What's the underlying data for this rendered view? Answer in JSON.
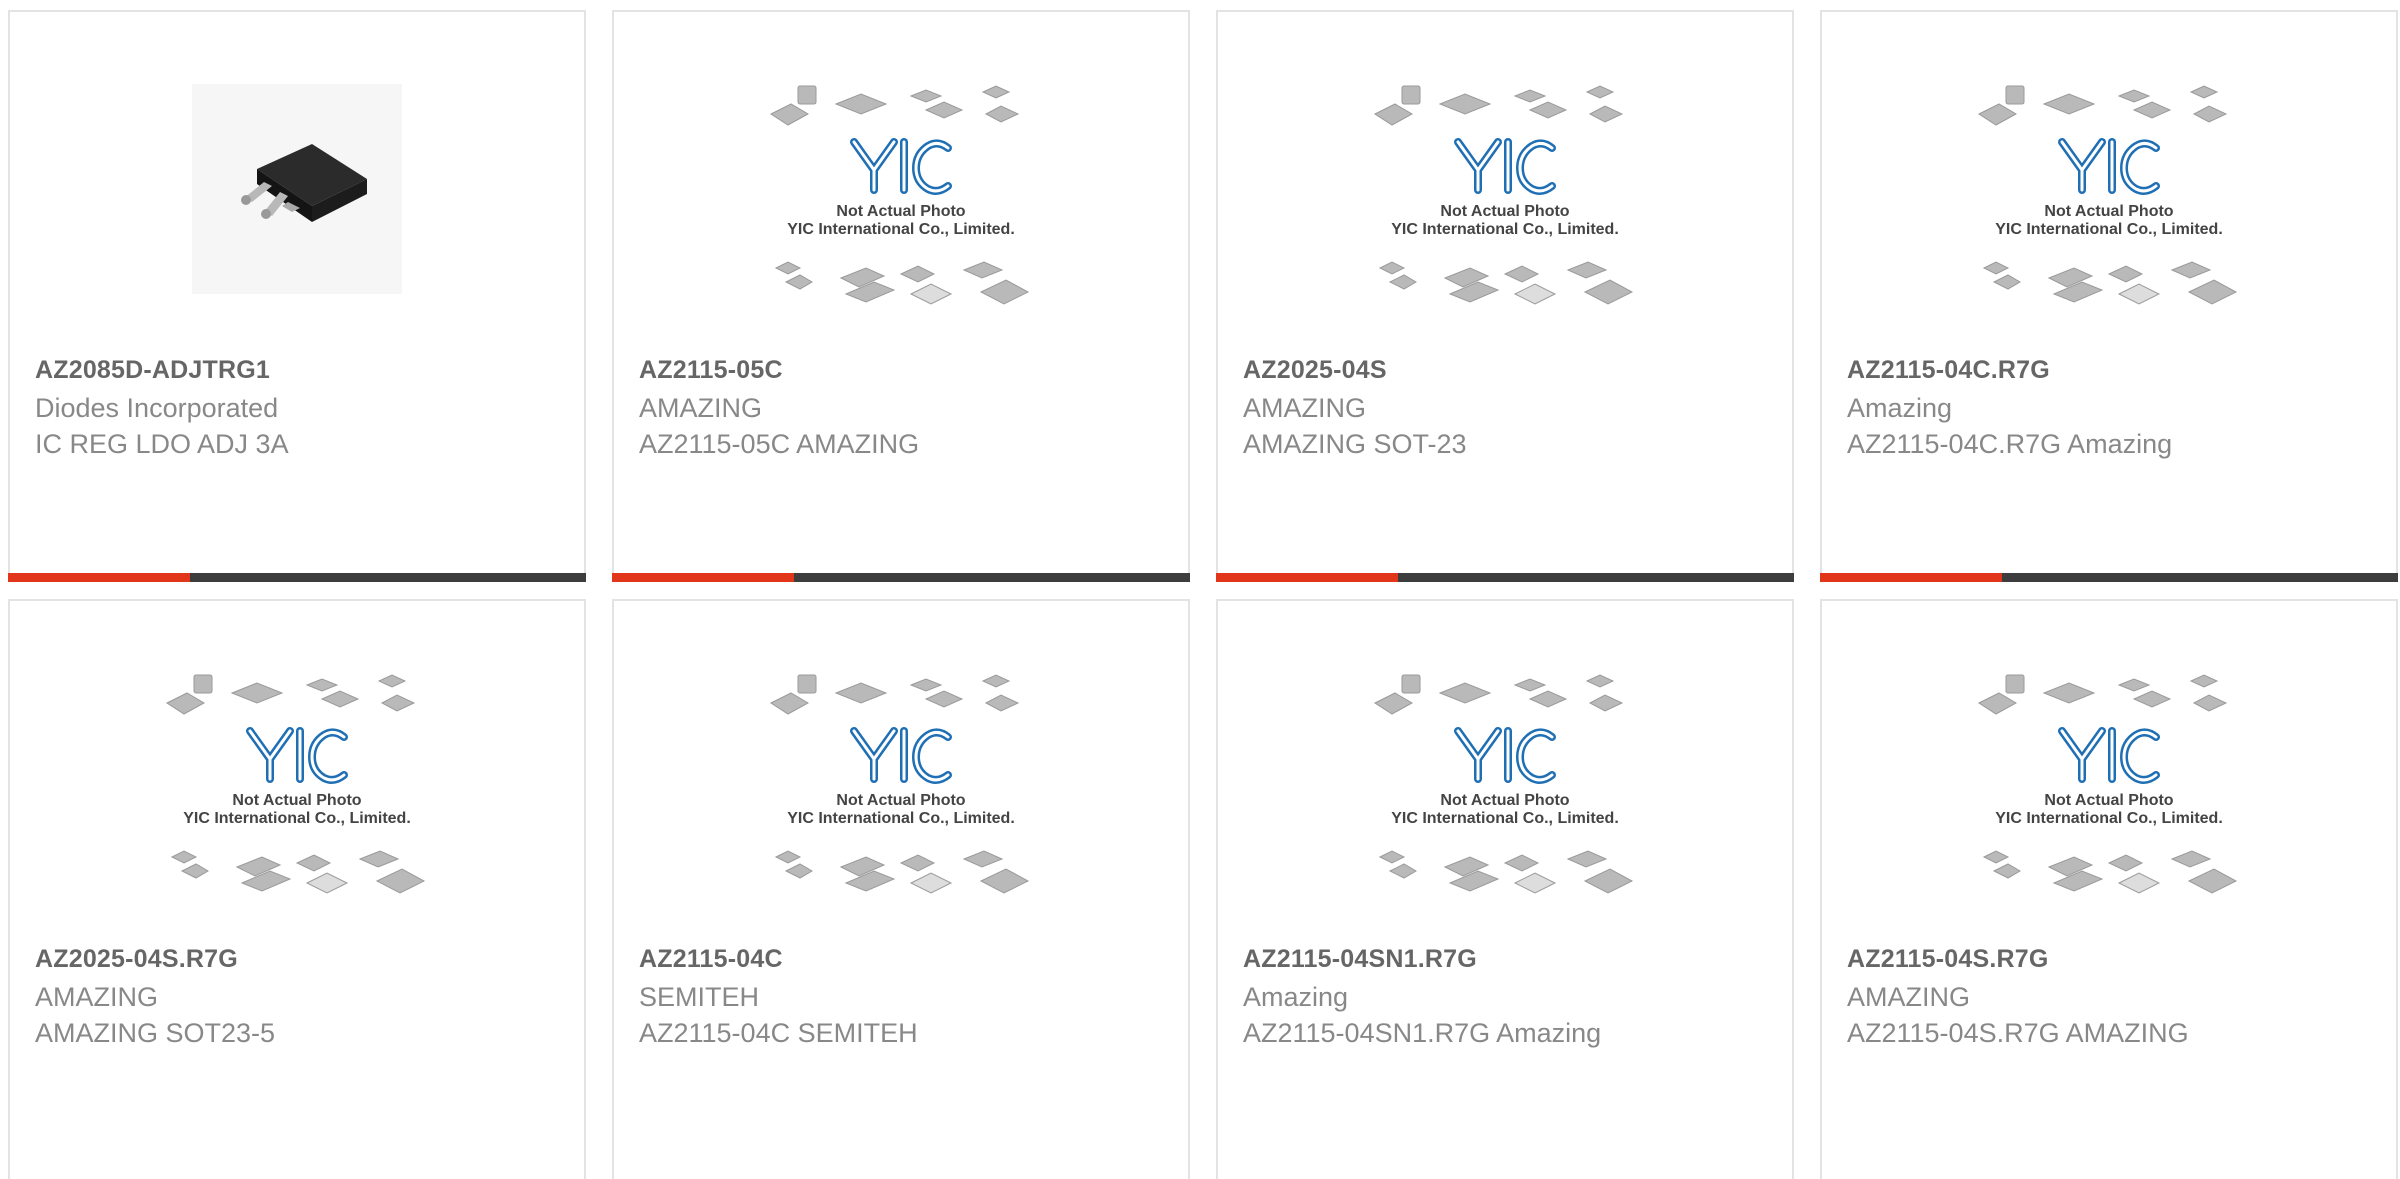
{
  "products": [
    {
      "part": "AZ2085D-ADJTRG1",
      "manufacturer": "Diodes Incorporated",
      "description": "IC REG LDO ADJ 3A",
      "image": "dpak-chip-photo"
    },
    {
      "part": "AZ2115-05C",
      "manufacturer": "AMAZING",
      "description": "AZ2115-05C AMAZING",
      "image": "yic-placeholder"
    },
    {
      "part": "AZ2025-04S",
      "manufacturer": "AMAZING",
      "description": "AMAZING SOT-23",
      "image": "yic-placeholder"
    },
    {
      "part": "AZ2115-04C.R7G",
      "manufacturer": "Amazing",
      "description": "AZ2115-04C.R7G Amazing",
      "image": "yic-placeholder"
    },
    {
      "part": "AZ2025-04S.R7G",
      "manufacturer": "AMAZING",
      "description": "AMAZING SOT23-5",
      "image": "yic-placeholder"
    },
    {
      "part": "AZ2115-04C",
      "manufacturer": "SEMITEH",
      "description": "AZ2115-04C SEMITEH",
      "image": "yic-placeholder"
    },
    {
      "part": "AZ2115-04SN1.R7G",
      "manufacturer": "Amazing",
      "description": "AZ2115-04SN1.R7G Amazing",
      "image": "yic-placeholder"
    },
    {
      "part": "AZ2115-04S.R7G",
      "manufacturer": "AMAZING",
      "description": "AZ2115-04S.R7G AMAZING",
      "image": "yic-placeholder"
    }
  ],
  "placeholder": {
    "logo_text": "YIC",
    "line1": "Not Actual Photo",
    "line2": "YIC International Co., Limited."
  },
  "colors": {
    "accent": "#e2361b",
    "bar": "#3d3d3d",
    "logo_blue": "#1f6fb5"
  }
}
